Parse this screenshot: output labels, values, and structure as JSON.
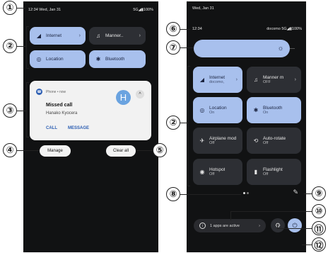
{
  "left_panel": {
    "status_bar": {
      "time_date": "12:34 Wed, Jan 31",
      "right": "5G◢▮100%"
    },
    "tiles": [
      {
        "label": "Internet",
        "icon": "signal-icon",
        "glyph": "◢",
        "chevron": "›",
        "state": "on"
      },
      {
        "label": "Manner..",
        "icon": "bell-icon",
        "glyph": "♫",
        "chevron": "›",
        "state": "off"
      },
      {
        "label": "Location",
        "icon": "location-icon",
        "glyph": "◎",
        "chevron": "",
        "state": "on"
      },
      {
        "label": "Bluetooth",
        "icon": "bluetooth-icon",
        "glyph": "✱",
        "chevron": "",
        "state": "on"
      }
    ],
    "notification": {
      "app": "Phone • now",
      "title": "Missed call",
      "name": "Hanako Kyocera",
      "avatar_letter": "H",
      "expand": "^",
      "actions": [
        "CALL",
        "MESSAGE"
      ]
    },
    "manage_label": "Manage",
    "clear_all_label": "Clear all"
  },
  "right_panel": {
    "date": "Wed, Jan 31",
    "status_bar": {
      "time": "12:34",
      "right": "docomo 5G◢▮100%"
    },
    "tiles": [
      {
        "label": "Internet",
        "sub": "docomo,",
        "glyph": "◢",
        "icon": "signal-icon",
        "chevron": "›",
        "state": "on"
      },
      {
        "label": "Manner m",
        "sub": "OFF",
        "glyph": "♫",
        "icon": "bell-icon",
        "chevron": "›",
        "state": "off"
      },
      {
        "label": "Location",
        "sub": "On",
        "glyph": "◎",
        "icon": "location-icon",
        "chevron": "",
        "state": "on"
      },
      {
        "label": "Bluetooth",
        "sub": "On",
        "glyph": "✱",
        "icon": "bluetooth-icon",
        "chevron": "",
        "state": "on"
      },
      {
        "label": "Airplane mod",
        "sub": "Off",
        "glyph": "✈",
        "icon": "airplane-icon",
        "chevron": "",
        "state": "off"
      },
      {
        "label": "Auto-rotate",
        "sub": "Off",
        "glyph": "⟲",
        "icon": "rotate-icon",
        "chevron": "",
        "state": "off"
      },
      {
        "label": "Hotspot",
        "sub": "Off",
        "glyph": "◉",
        "icon": "hotspot-icon",
        "chevron": "",
        "state": "off"
      },
      {
        "label": "Flashlight",
        "sub": "Off",
        "glyph": "▮",
        "icon": "flashlight-icon",
        "chevron": "",
        "state": "off"
      }
    ],
    "active_apps": "1 apps are active",
    "active_apps_chevron": "›"
  },
  "callouts": [
    "①",
    "②",
    "③",
    "④",
    "⑤",
    "⑥",
    "⑦",
    "②",
    "⑧",
    "⑨",
    "⑩",
    "⑪",
    "⑫"
  ]
}
